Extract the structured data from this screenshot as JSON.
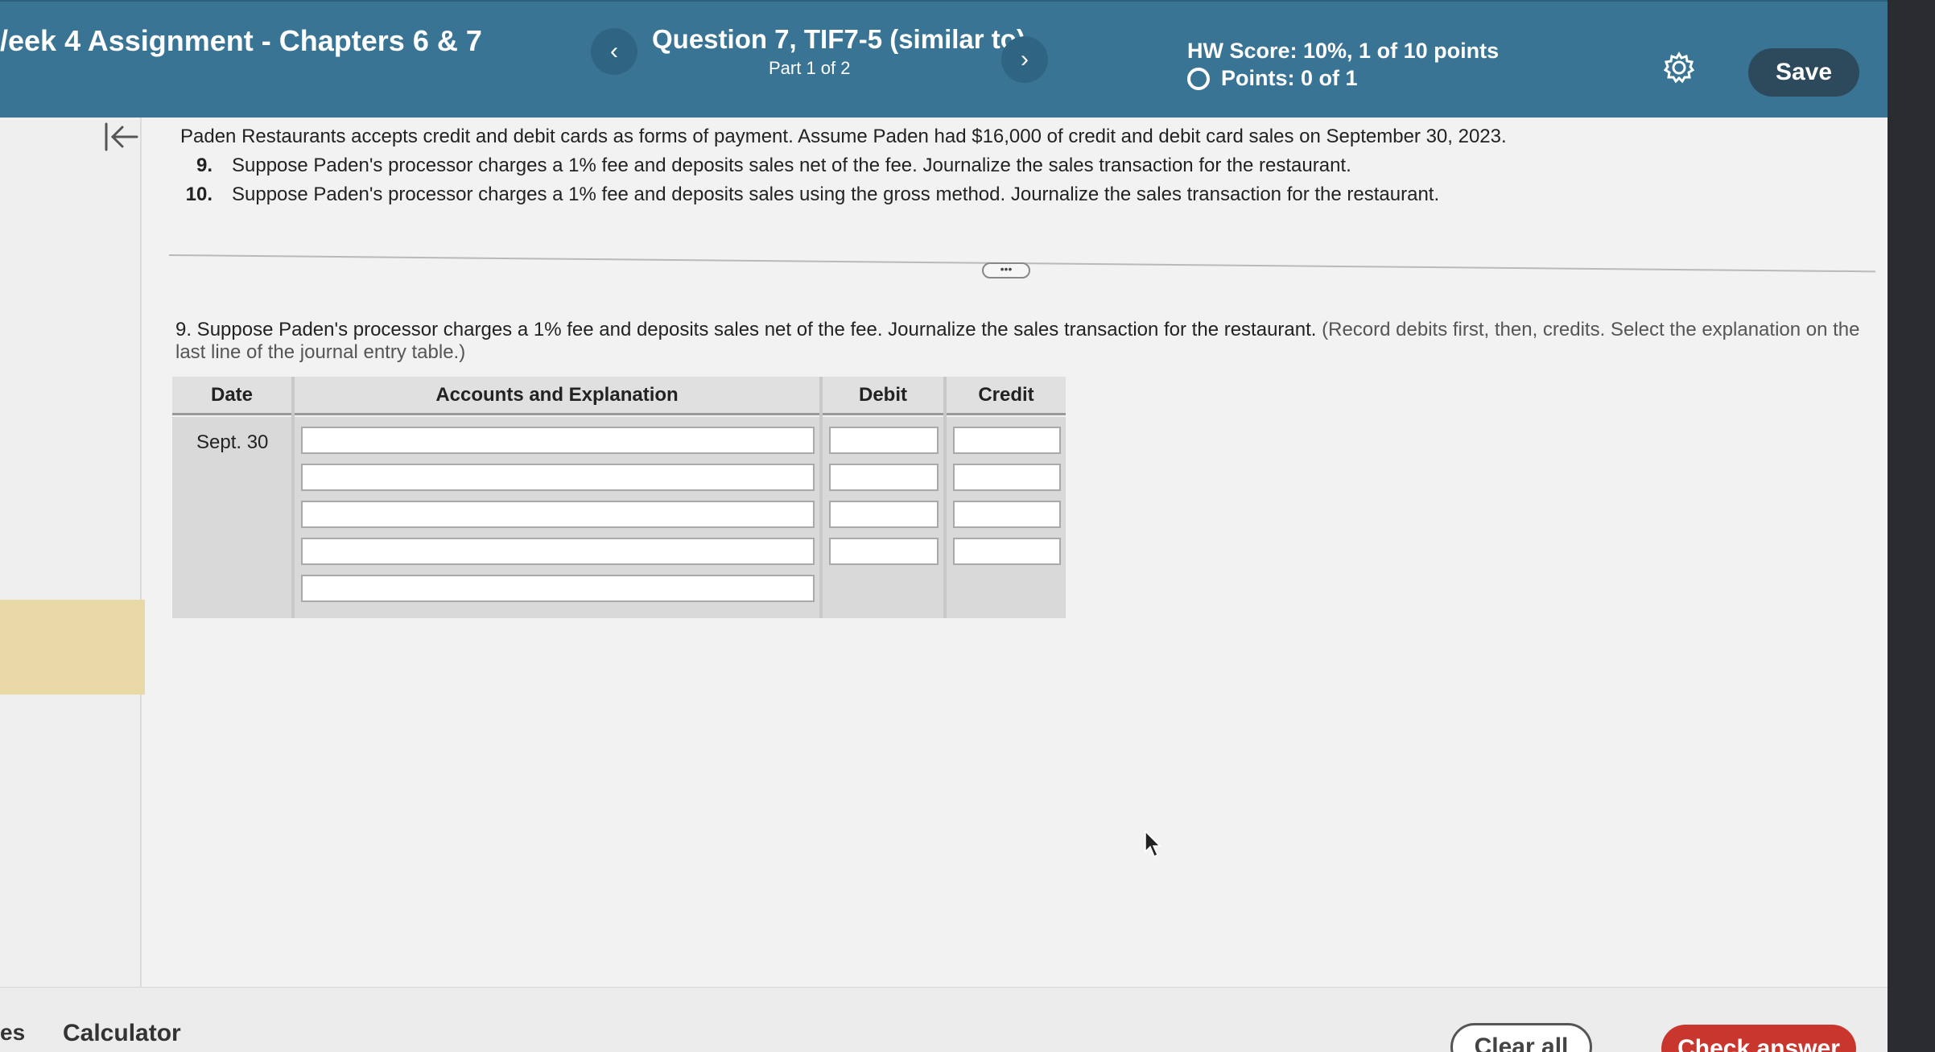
{
  "header": {
    "assignment_title": "/eek 4 Assignment - Chapters 6 & 7",
    "prev_icon": "chevron-left-icon",
    "question_title": "Question 7, TIF7-5 (similar to)",
    "question_part": "Part 1 of 2",
    "next_icon": "chevron-right-icon",
    "hw_score": "HW Score: 10%, 1 of 10 points",
    "points": "Points: 0 of 1",
    "settings_icon": "gear-icon",
    "save_label": "Save",
    "colors": {
      "bar": "#3a7494",
      "save": "#2d4a5c",
      "check": "#c9362d"
    }
  },
  "question": {
    "intro": "Paden Restaurants accepts credit and debit cards as forms of payment. Assume Paden had $16,000 of credit and debit card sales on September 30, 2023.",
    "items": [
      {
        "num": "9.",
        "text": "Suppose Paden's processor charges a 1% fee and deposits sales net of the fee. Journalize the sales transaction for the restaurant."
      },
      {
        "num": "10.",
        "text": "Suppose Paden's processor charges a 1% fee and deposits sales using the gross method. Journalize the sales transaction for the restaurant."
      }
    ],
    "more_label": "•••",
    "instruction": "9. Suppose Paden's processor charges a 1% fee and deposits sales net of the fee. Journalize the sales transaction for the restaurant.",
    "instruction_hint": "(Record debits first, then, credits. Select the explanation on the last line of the journal entry table.)"
  },
  "journal": {
    "headers": {
      "date": "Date",
      "accounts": "Accounts and Explanation",
      "debit": "Debit",
      "credit": "Credit"
    },
    "date_value": "Sept. 30",
    "account_rows": [
      "",
      "",
      "",
      "",
      ""
    ],
    "debit_rows": [
      "",
      "",
      "",
      ""
    ],
    "credit_rows": [
      "",
      "",
      "",
      ""
    ]
  },
  "bottom": {
    "left_fragment": "es",
    "calculator": "Calculator",
    "clear_all": "Clear all",
    "check_answer": "Check answer"
  }
}
